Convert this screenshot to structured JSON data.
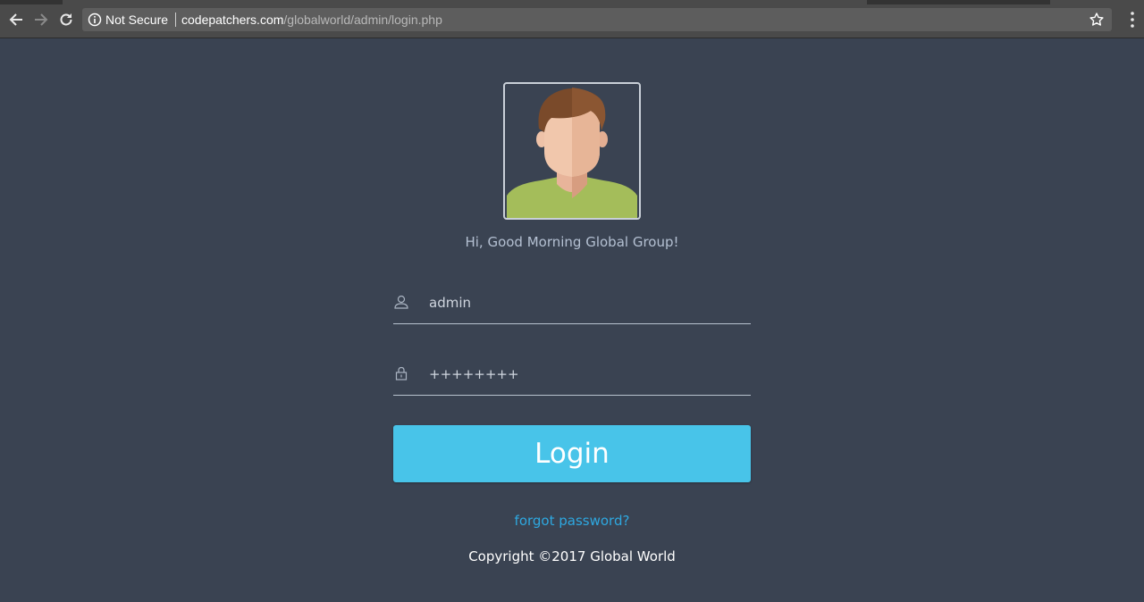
{
  "browser": {
    "security_label": "Not Secure",
    "url_host": "codepatchers.com",
    "url_path": "/globalworld/admin/login.php",
    "icons": [
      "back-icon",
      "forward-icon",
      "reload-icon",
      "info-icon",
      "star-icon",
      "menu-icon"
    ]
  },
  "login": {
    "greeting": "Hi, Good Morning Global Group!",
    "username_value": "admin",
    "password_value": "++++++++",
    "login_label": "Login",
    "forgot_label": "forgot password?",
    "copyright": "Copyright ©2017 Global World"
  },
  "colors": {
    "background": "#3a4352",
    "button": "#48c4e9",
    "link": "#2ea8e0",
    "greeting_text": "#b4c0d2"
  }
}
